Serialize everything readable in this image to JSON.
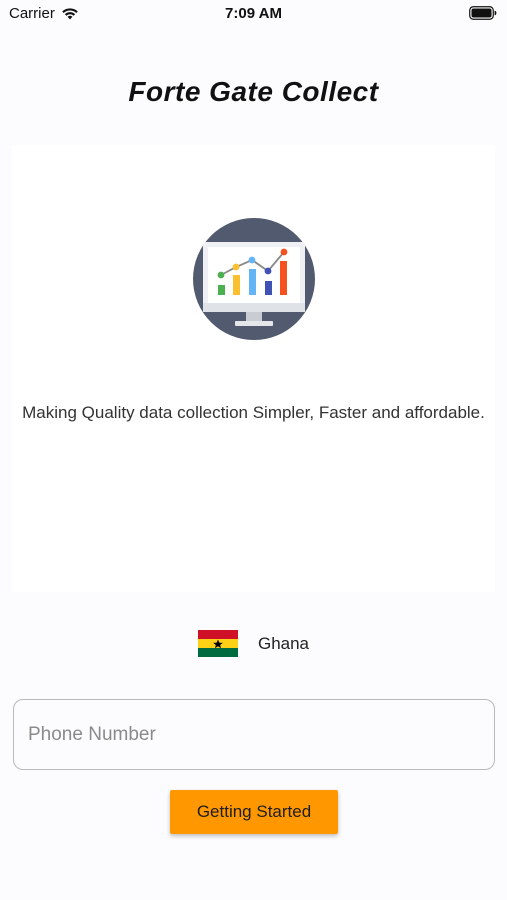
{
  "status_bar": {
    "carrier": "Carrier",
    "time": "7:09 AM",
    "wifi_icon": "wifi-icon",
    "battery_icon": "battery-icon"
  },
  "app": {
    "title": "Forte Gate Collect"
  },
  "hero": {
    "illustration_icon": "monitor-chart-icon",
    "tagline": "Making Quality data collection Simpler, Faster and affordable."
  },
  "country": {
    "name": "Ghana",
    "flag_icon": "ghana-flag-icon"
  },
  "phone": {
    "placeholder": "Phone Number",
    "value": ""
  },
  "actions": {
    "start_label": "Getting Started"
  },
  "colors": {
    "accent": "#ff9800",
    "background": "#fcfcfe",
    "illustration_circle": "#515a6e"
  }
}
